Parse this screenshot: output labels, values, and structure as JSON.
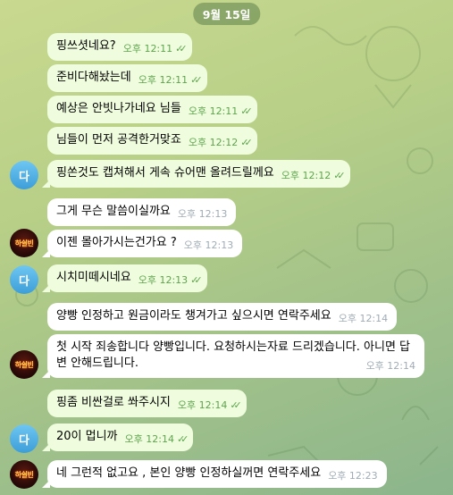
{
  "date_label": "9월 15일",
  "messages": [
    {
      "text": "핑쓰셧네요?",
      "time": "오후 12:11",
      "type": "out"
    },
    {
      "text": "준비다해놨는데",
      "time": "오후 12:11",
      "type": "out"
    },
    {
      "text": "예상은 안빗나가네요 님들",
      "time": "오후 12:11",
      "type": "out"
    },
    {
      "text": "님들이 먼저 공격한거맞죠",
      "time": "오후 12:12",
      "type": "out"
    },
    {
      "text": "핑쏜것도 캡쳐해서 게속 슈어맨 올려드릴께요",
      "time": "오후 12:12",
      "type": "out"
    },
    {
      "text": "그게 무슨 말씀이실까요",
      "time": "오후 12:13",
      "type": "in"
    },
    {
      "text": "이젠 몰아가시는건가요 ?",
      "time": "오후 12:13",
      "type": "in"
    },
    {
      "text": "시치미떼시네요",
      "time": "오후 12:13",
      "type": "out"
    },
    {
      "text": "양빵 인정하고 원금이라도 챙겨가고 싶으시면 연락주세요",
      "time": "오후 12:14",
      "type": "in"
    },
    {
      "text": "첫 시작 죄송합니다 양빵입니다. 요청하시는자료 드리겠습니다. 아니면 답변 안해드립니다.",
      "time": "오후 12:14",
      "type": "in"
    },
    {
      "text": "핑좀 비싼걸로 쏴주시지",
      "time": "오후 12:14",
      "type": "out"
    },
    {
      "text": "20이 멉니까",
      "time": "오후 12:14",
      "type": "out"
    },
    {
      "text": "네 그런적 없고요 , 본인 양빵 인정하실꺼면 연락주세요",
      "time": "오후 12:23",
      "type": "in"
    }
  ],
  "avatars": {
    "da_label": "다",
    "logo_label": "하쉴빈"
  },
  "colors": {
    "outgoing_bubble": "#effdde",
    "incoming_bubble": "#ffffff",
    "outgoing_time": "#5ea54d",
    "incoming_time": "#a0acb6",
    "avatar_blue": "#4aa9e0"
  },
  "icons": {
    "read_receipt": "double-check-icon"
  }
}
